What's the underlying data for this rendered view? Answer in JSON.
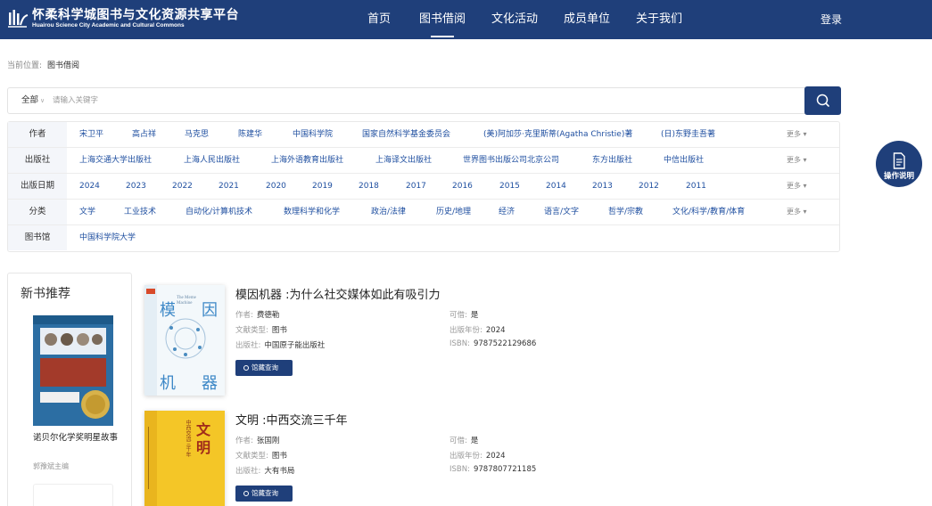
{
  "header": {
    "title": "怀柔科学城图书与文化资源共享平台",
    "subtitle": "Huairou Science City Academic and Cultural Commons",
    "nav": [
      {
        "label": "首页",
        "active": false
      },
      {
        "label": "图书借阅",
        "active": true
      },
      {
        "label": "文化活动",
        "active": false
      },
      {
        "label": "成员单位",
        "active": false
      },
      {
        "label": "关于我们",
        "active": false
      }
    ],
    "login_label": "登录",
    "background_color": "#1f3f7a"
  },
  "breadcrumb": {
    "prefix": "当前位置:",
    "current": "图书借阅"
  },
  "search": {
    "scope_label": "全部",
    "placeholder": "请输入关键字",
    "button_icon": "search-icon"
  },
  "filters": {
    "more_label": "更多",
    "rows": [
      {
        "label": "作者",
        "items": [
          "宋卫平",
          "高占祥",
          "马克思",
          "陈建华",
          "中国科学院",
          "国家自然科学基金委员会",
          "(美)阿加莎·克里斯蒂(Agatha Christie)著",
          "(日)东野圭吾著"
        ]
      },
      {
        "label": "出版社",
        "items": [
          "上海交通大学出版社",
          "上海人民出版社",
          "上海外语教育出版社",
          "上海译文出版社",
          "世界图书出版公司北京公司",
          "东方出版社",
          "中信出版社"
        ]
      },
      {
        "label": "出版日期",
        "items": [
          "2024",
          "2023",
          "2022",
          "2021",
          "2020",
          "2019",
          "2018",
          "2017",
          "2016",
          "2015",
          "2014",
          "2013",
          "2012",
          "2011"
        ]
      },
      {
        "label": "分类",
        "items": [
          "文学",
          "工业技术",
          "自动化/计算机技术",
          "数理科学和化学",
          "政治/法律",
          "历史/地理",
          "经济",
          "语言/文字",
          "哲学/宗教",
          "文化/科学/教育/体育"
        ]
      },
      {
        "label": "图书馆",
        "items": [
          "中国科学院大学"
        ]
      }
    ]
  },
  "guide": {
    "label": "操作说明",
    "icon": "document-icon"
  },
  "sidebar": {
    "title": "新书推荐",
    "book": {
      "title": "诺贝尔化学奖明星故事",
      "author": "郭豫斌主编",
      "cover_text": "诺贝尔化学奖明星故事",
      "cover_en": "The Nobel Prize in Chemistry"
    }
  },
  "books": [
    {
      "title": "模因机器 :为什么社交媒体如此有吸引力",
      "author_label": "作者:",
      "author": "费德勒",
      "type_label": "文献类型:",
      "type": "图书",
      "publisher_label": "出版社:",
      "publisher": "中国原子能出版社",
      "borrowable_label": "可借:",
      "borrowable": "是",
      "year_label": "出版年份:",
      "year": "2024",
      "isbn_label": "ISBN:",
      "isbn": "9787522129686",
      "holding_label": "馆藏查询",
      "cover_chars": [
        "模",
        "因",
        "机",
        "器"
      ],
      "cover_en": "The Meme Machine"
    },
    {
      "title": "文明 :中西交流三千年",
      "author_label": "作者:",
      "author": "张国刚",
      "type_label": "文献类型:",
      "type": "图书",
      "publisher_label": "出版社:",
      "publisher": "大有书局",
      "borrowable_label": "可借:",
      "borrowable": "是",
      "year_label": "出版年份:",
      "year": "2024",
      "isbn_label": "ISBN:",
      "isbn": "9787807721185",
      "holding_label": "馆藏查询",
      "cover_chars": [
        "文",
        "明"
      ],
      "cover_sub": "中西交流三千年"
    }
  ]
}
